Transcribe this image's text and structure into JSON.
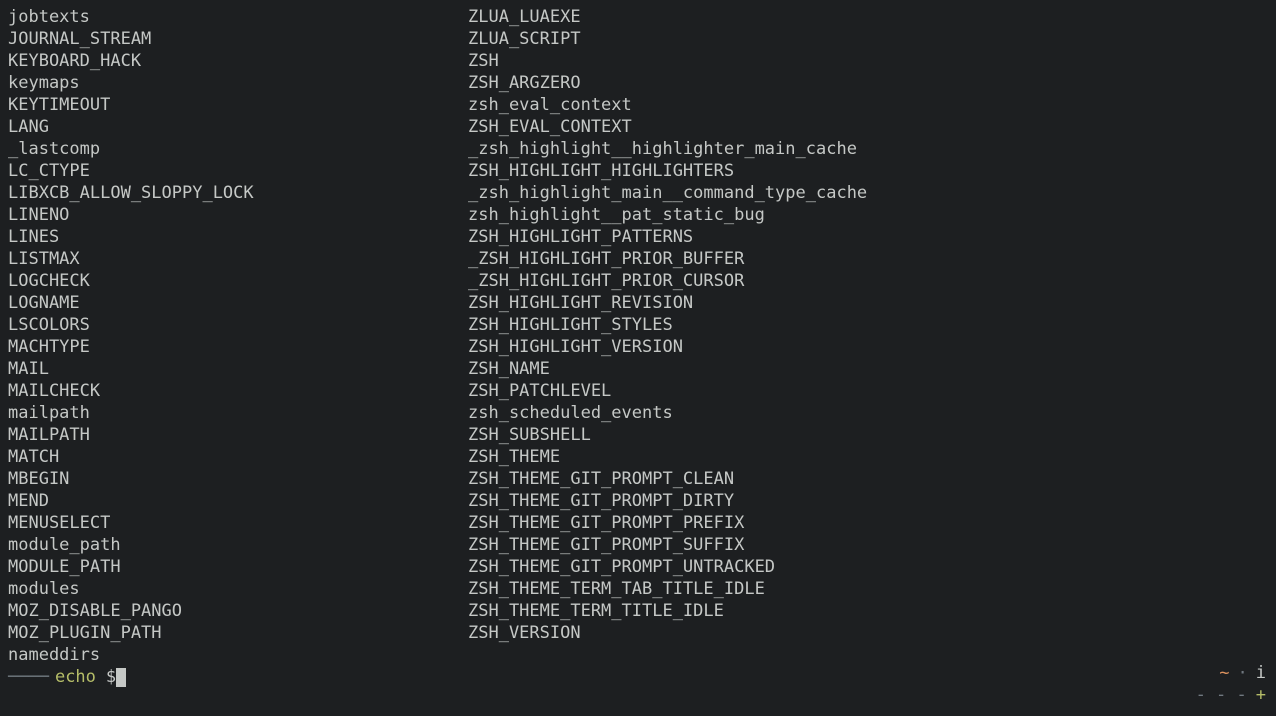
{
  "columns": {
    "left": [
      "jobtexts",
      "JOURNAL_STREAM",
      "KEYBOARD_HACK",
      "keymaps",
      "KEYTIMEOUT",
      "LANG",
      "_lastcomp",
      "LC_CTYPE",
      "LIBXCB_ALLOW_SLOPPY_LOCK",
      "LINENO",
      "LINES",
      "LISTMAX",
      "LOGCHECK",
      "LOGNAME",
      "LSCOLORS",
      "MACHTYPE",
      "MAIL",
      "MAILCHECK",
      "mailpath",
      "MAILPATH",
      "MATCH",
      "MBEGIN",
      "MEND",
      "MENUSELECT",
      "module_path",
      "MODULE_PATH",
      "modules",
      "MOZ_DISABLE_PANGO",
      "MOZ_PLUGIN_PATH",
      "nameddirs"
    ],
    "right": [
      "ZLUA_LUAEXE",
      "ZLUA_SCRIPT",
      "ZSH",
      "ZSH_ARGZERO",
      "zsh_eval_context",
      "ZSH_EVAL_CONTEXT",
      "_zsh_highlight__highlighter_main_cache",
      "ZSH_HIGHLIGHT_HIGHLIGHTERS",
      "_zsh_highlight_main__command_type_cache",
      "zsh_highlight__pat_static_bug",
      "ZSH_HIGHLIGHT_PATTERNS",
      "_ZSH_HIGHLIGHT_PRIOR_BUFFER",
      "_ZSH_HIGHLIGHT_PRIOR_CURSOR",
      "ZSH_HIGHLIGHT_REVISION",
      "ZSH_HIGHLIGHT_STYLES",
      "ZSH_HIGHLIGHT_VERSION",
      "ZSH_NAME",
      "ZSH_PATCHLEVEL",
      "zsh_scheduled_events",
      "ZSH_SUBSHELL",
      "ZSH_THEME",
      "ZSH_THEME_GIT_PROMPT_CLEAN",
      "ZSH_THEME_GIT_PROMPT_DIRTY",
      "ZSH_THEME_GIT_PROMPT_PREFIX",
      "ZSH_THEME_GIT_PROMPT_SUFFIX",
      "ZSH_THEME_GIT_PROMPT_UNTRACKED",
      "ZSH_THEME_TERM_TAB_TITLE_IDLE",
      "ZSH_THEME_TERM_TITLE_IDLE",
      "ZSH_VERSION"
    ]
  },
  "prompt": {
    "dashes": "────",
    "command": "echo",
    "argument": "$"
  },
  "status": {
    "cwd": "~",
    "separator": "·",
    "mode": "i",
    "dashes": "-  -  -",
    "plus": "+"
  }
}
